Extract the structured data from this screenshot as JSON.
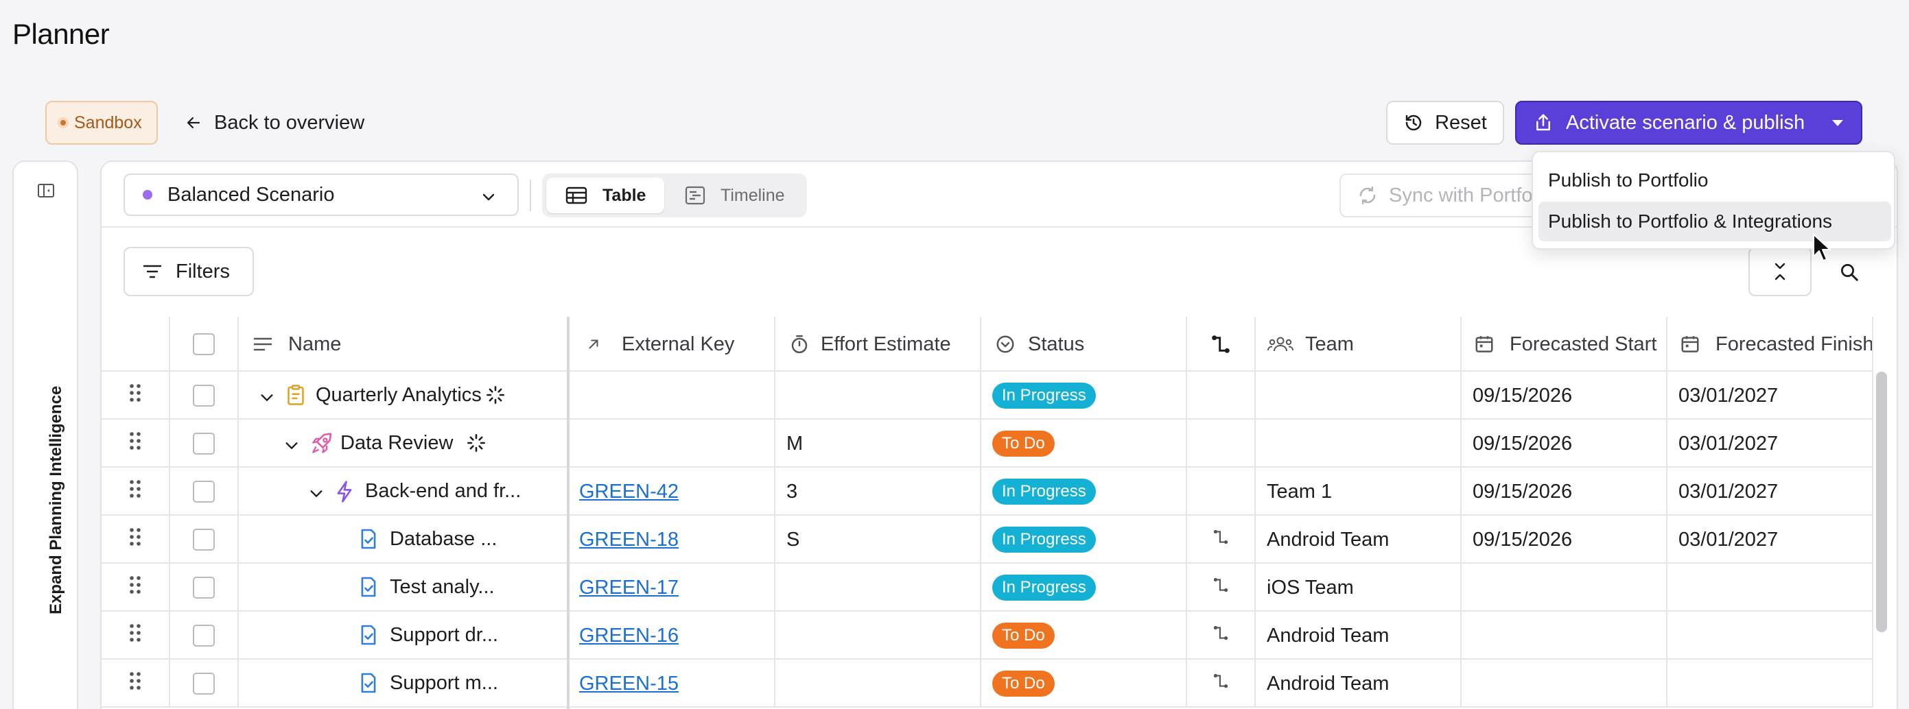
{
  "app": {
    "title": "Planner"
  },
  "header": {
    "sandbox_label": "Sandbox",
    "back_label": "Back to overview",
    "reset_label": "Reset",
    "activate_label": "Activate scenario & publish"
  },
  "side_panel": {
    "label": "Expand Planning Intelligence"
  },
  "toolbar": {
    "scenario": "Balanced Scenario",
    "tab_table": "Table",
    "tab_timeline": "Timeline",
    "sync_label": "Sync with Portfolio",
    "filters_label": "Filters"
  },
  "dropdown": {
    "items": [
      "Publish to Portfolio",
      "Publish to Portfolio & Integrations"
    ]
  },
  "colors": {
    "accent": "#5a3fd8",
    "in_progress": "#14b1d4",
    "to_do": "#f0741f",
    "link": "#1a6fd4"
  },
  "table": {
    "columns": {
      "name": "Name",
      "external_key": "External Key",
      "effort": "Effort Estimate",
      "status": "Status",
      "team": "Team",
      "forecast_start": "Forecasted Start",
      "forecast_finish": "Forecasted Finish"
    },
    "rows": [
      {
        "level": 0,
        "icon": "clipboard-icon",
        "name": "Quarterly Analytics",
        "key": "",
        "effort": "",
        "status": "In Progress",
        "dep": false,
        "team": "",
        "start": "09/15/2026",
        "finish": "03/01/2027"
      },
      {
        "level": 1,
        "icon": "rocket-icon",
        "name": "Data Review",
        "key": "",
        "effort": "M",
        "status": "To Do",
        "dep": false,
        "team": "",
        "start": "09/15/2026",
        "finish": "03/01/2027"
      },
      {
        "level": 2,
        "icon": "bolt-icon",
        "name": "Back-end and fr...",
        "key": "GREEN-42",
        "effort": "3",
        "status": "In Progress",
        "dep": false,
        "team": "Team 1",
        "start": "09/15/2026",
        "finish": "03/01/2027"
      },
      {
        "level": 3,
        "icon": "task-icon",
        "name": "Database ...",
        "key": "GREEN-18",
        "effort": "S",
        "status": "In Progress",
        "dep": true,
        "team": "Android Team",
        "start": "09/15/2026",
        "finish": "03/01/2027"
      },
      {
        "level": 3,
        "icon": "task-icon",
        "name": "Test analy...",
        "key": "GREEN-17",
        "effort": "",
        "status": "In Progress",
        "dep": true,
        "team": "iOS Team",
        "start": "",
        "finish": ""
      },
      {
        "level": 3,
        "icon": "task-icon",
        "name": "Support dr...",
        "key": "GREEN-16",
        "effort": "",
        "status": "To Do",
        "dep": true,
        "team": "Android Team",
        "start": "",
        "finish": ""
      },
      {
        "level": 3,
        "icon": "task-icon",
        "name": "Support m...",
        "key": "GREEN-15",
        "effort": "",
        "status": "To Do",
        "dep": true,
        "team": "Android Team",
        "start": "",
        "finish": ""
      }
    ]
  }
}
